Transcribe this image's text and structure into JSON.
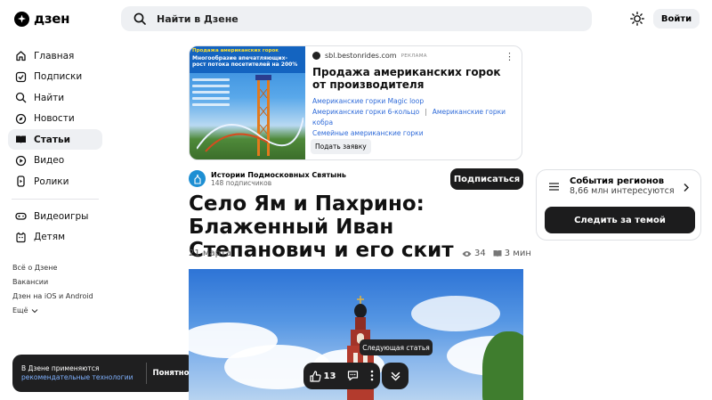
{
  "header": {
    "logo_text": "дзен",
    "search_placeholder": "Найти в Дзене",
    "login_label": "Войти"
  },
  "sidebar": {
    "items": [
      {
        "label": "Главная",
        "icon": "home-icon"
      },
      {
        "label": "Подписки",
        "icon": "subscriptions-icon"
      },
      {
        "label": "Найти",
        "icon": "search-icon"
      },
      {
        "label": "Новости",
        "icon": "news-icon"
      },
      {
        "label": "Статьи",
        "icon": "articles-icon",
        "active": true
      },
      {
        "label": "Видео",
        "icon": "video-icon"
      },
      {
        "label": "Ролики",
        "icon": "shorts-icon"
      }
    ],
    "items2": [
      {
        "label": "Видеоигры",
        "icon": "gamepad-icon"
      },
      {
        "label": "Детям",
        "icon": "kids-icon"
      }
    ],
    "footer_links": [
      "Всё о Дзене",
      "Вакансии",
      "Дзен на iOS и Android",
      "Ещё"
    ]
  },
  "cookie_toast": {
    "text": "В Дзене применяются",
    "link": "рекомендательные технологии",
    "button": "Понятно"
  },
  "ad": {
    "image_headline_yellow": "Продажа американских горок",
    "image_headline_white": "Многообразие впечатляющих-рост потока посетителей на 200%",
    "domain": "sbl.bestonrides.com",
    "tag": "РЕКЛАМА",
    "title": "Продажа американских горок от производителя",
    "links": [
      "Американские горки Magic loop",
      "Американские горки 6-кольцо",
      "Американские горки кобра",
      "Семейные американские горки"
    ],
    "cta": "Подать заявку"
  },
  "channel": {
    "name": "Истории Подмосковных Святынь",
    "subscribers": "148 подписчиков",
    "subscribe_label": "Подписаться"
  },
  "article": {
    "title": "Село Ям и Пахрино: Блаженный Иван Степанович и его скит",
    "date": "21 марта",
    "views": "34",
    "read_time": "3 мин"
  },
  "action_bar": {
    "likes": "13",
    "next_tooltip": "Следующая статья"
  },
  "widget": {
    "title": "События регионов",
    "subtitle": "8,66 млн интересуются",
    "button": "Следить за темой"
  },
  "colors": {
    "accent_dark": "#1c1c1d",
    "link_blue": "#2f6bd9",
    "surface_gray": "#eef0f3"
  }
}
